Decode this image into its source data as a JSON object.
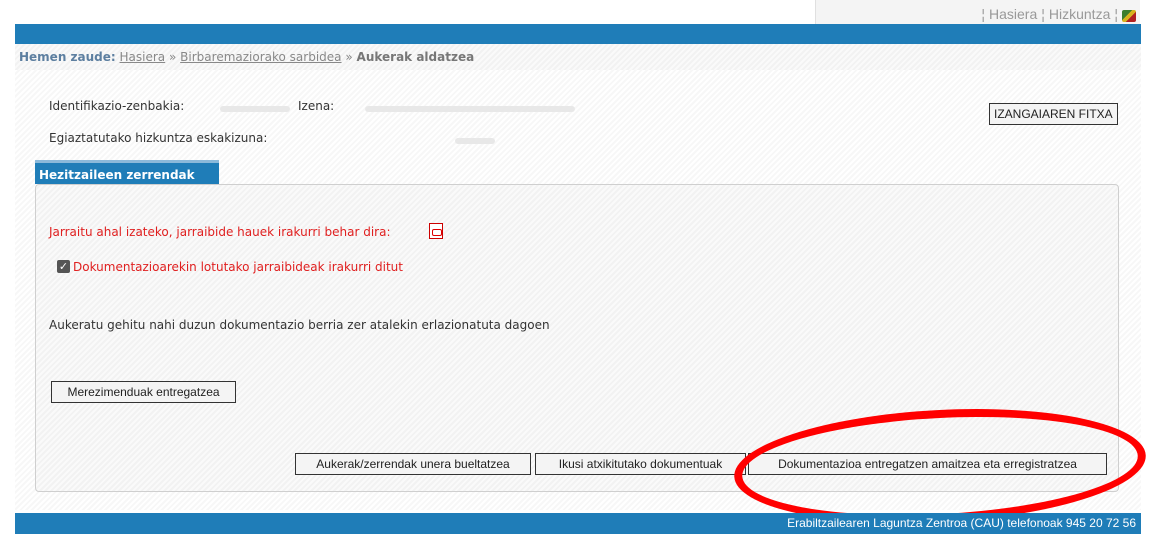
{
  "top_links": {
    "home": "Hasiera",
    "language": "Hizkuntza",
    "separator": "¦"
  },
  "breadcrumb": {
    "label": "Hemen zaude:",
    "items": [
      "Hasiera",
      "Birbaremaziorako sarbidea"
    ],
    "separator": "»",
    "current": "Aukerak aldatzea"
  },
  "candidate": {
    "id_label": "Identifikazio-zenbakia:",
    "name_label": "Izena:",
    "language_label": "Egiaztatutako hizkuntza eskakizuna:",
    "fitxa_button": "IZANGAIAREN FITXA"
  },
  "tab": {
    "label": "Hezitzaileen zerrendak"
  },
  "panel": {
    "instructions_text": "Jarraitu ahal izateko, jarraibide hauek irakurri behar dira:",
    "checkbox_label": "Dokumentazioarekin lotutako jarraibideak irakurri ditut",
    "checkbox_checked": true,
    "select_text": "Aukeratu gehitu nahi duzun dokumentazio berria zer atalekin erlazionatuta dagoen",
    "merits_button": "Merezimenduak entregatzea",
    "reset_button": "Aukerak/zerrendak unera bueltatzea",
    "view_docs_button": "Ikusi atxikitutako dokumentuak",
    "finish_button": "Dokumentazioa entregatzen amaitzea eta erregistratzea"
  },
  "footer": {
    "text": "Erabiltzailearen Laguntza Zentroa (CAU) telefonoak 945 20 72 56"
  },
  "colors": {
    "primary": "#1f7db8",
    "alert": "#e02020",
    "highlight": "#ff0000"
  }
}
